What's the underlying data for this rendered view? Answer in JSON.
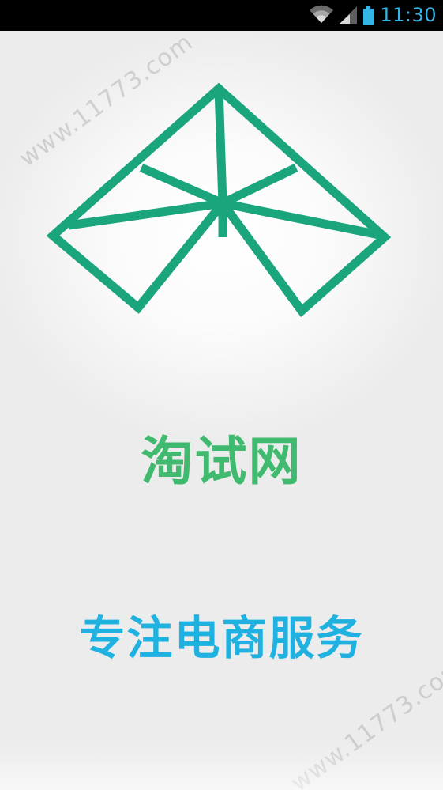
{
  "status_bar": {
    "time": "11:30",
    "icons": [
      "wifi-icon",
      "cellular-signal-icon",
      "battery-icon"
    ],
    "accent_color": "#33b5e5"
  },
  "splash": {
    "app_name": "淘试网",
    "slogan": "专注电商服务",
    "logo_icon": "geometric-mountain-logo-icon",
    "colors": {
      "logo": "#1aa57c",
      "app_name": "#3fba6e",
      "slogan": "#1fb2e0"
    }
  },
  "watermark": {
    "text": "www.11773.com"
  }
}
